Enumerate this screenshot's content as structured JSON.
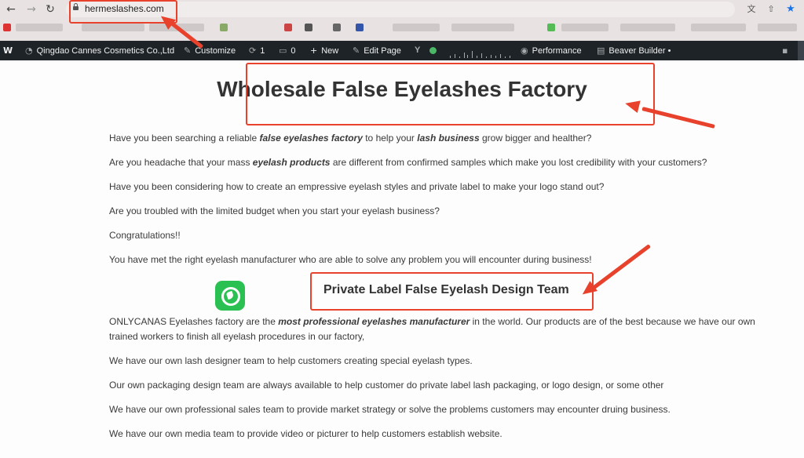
{
  "browser": {
    "url": "hermeslashes.com",
    "back_icon": "←",
    "forward_icon": "→",
    "reload_icon": "↻",
    "translate_icon": "文",
    "share_icon": "⇧",
    "star_icon": "★"
  },
  "admin_bar": {
    "wp_logo": "W",
    "site_name": "Qingdao Cannes Cosmetics Co.,Ltd",
    "customize": "Customize",
    "updates_count": "1",
    "comments_count": "0",
    "new_label": "New",
    "edit_page": "Edit Page",
    "yoast_label": "Y",
    "performance": "Performance",
    "beaver_builder": "Beaver Builder •"
  },
  "page": {
    "title": "Wholesale False Eyelashes Factory",
    "intro": [
      {
        "pre": "Have you been searching a reliable ",
        "em": "false eyelashes factory",
        "mid": " to help your ",
        "em2": "lash business",
        "post": " grow bigger and healther?"
      },
      {
        "pre": "Are you headache that your mass ",
        "em": "eyelash products",
        "post": " are different from confirmed samples which make you lost credibility with your customers?"
      },
      {
        "text": "Have you been considering how to create an empressive eyelash styles and private label to make your logo stand out?"
      },
      {
        "text": "Are you troubled with the limited budget when you start your eyelash business?"
      },
      {
        "text": "Congratulations!!"
      },
      {
        "text": "You have met the right eyelash manufacturer who are able to solve any problem you will encounter during business!"
      }
    ],
    "subtitle": "Private Label False Eyelash Design Team",
    "body": [
      {
        "pre": "ONLYCANAS Eyelashes factory are the ",
        "em": "most professional eyelashes manufacturer",
        "post": " in the world. Our products are of the best because we have our own"
      },
      {
        "text": "trained workers to finish all eyelash procedures in our factory,"
      },
      {
        "text": "We have our own lash designer team to help customers creating special eyelash types."
      },
      {
        "text": "Our own packaging design team are always available to help customer do private label lash packaging, or logo design, or some other"
      },
      {
        "text": "We have our own professional sales team to provide market strategy or solve the problems customers may encounter druing business."
      },
      {
        "text": "We have our own media team to provide video or picturer to help customers establish website."
      }
    ]
  },
  "colors": {
    "annotation": "#e8412c",
    "admin_bar": "#1d2327",
    "whatsapp": "#2ac152"
  }
}
